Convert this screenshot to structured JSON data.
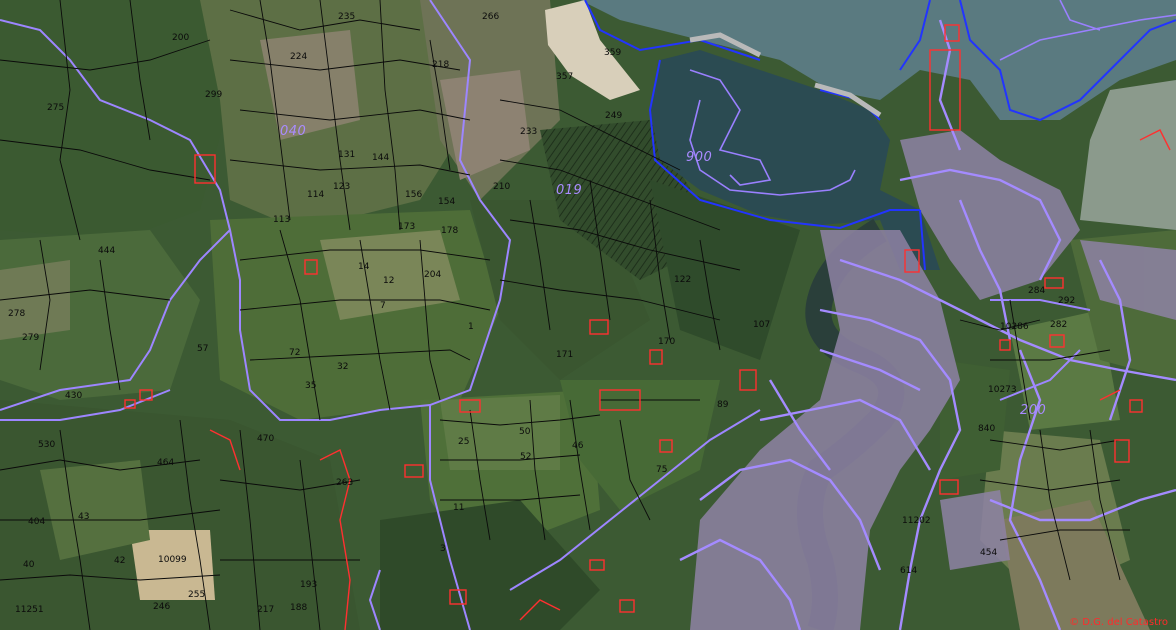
{
  "map": {
    "colors": {
      "sea": "#4e6e73",
      "bay": "#2f4d56",
      "beach": "#d9d2bf",
      "field_dark": "#2e4a27",
      "field_mid": "#4d6b3a",
      "field_light": "#7e8b5f",
      "bare_field": "#8a7f6a",
      "town": "#a07bd7",
      "road": "#9a82f2",
      "coast": "#1d2cff",
      "buildings": "#ff3b3b",
      "parcel_lines": "#0a0a0a"
    },
    "zone_labels": {
      "z040": "040",
      "z900": "900",
      "z200": "200",
      "z019": "019"
    },
    "parcel_labels": {
      "p200": "200",
      "p275": "275",
      "p279": "279",
      "p430": "430",
      "p278": "278",
      "p464": "464",
      "p470": "470",
      "p444": "444",
      "p299": "299",
      "p224": "224",
      "p113": "113",
      "p235": "235",
      "p266": "266",
      "p123": "123",
      "p131": "131",
      "p156": "156",
      "p144": "144",
      "p114": "114",
      "p154": "154",
      "p178": "178",
      "p204": "204",
      "p173": "173",
      "p357": "357",
      "p359": "359",
      "p249": "249",
      "p210": "210",
      "p218": "218",
      "p233": "233",
      "p122": "122",
      "p107": "107",
      "p57": "57",
      "p72": "72",
      "p7": "7",
      "p14": "14",
      "p35": "35",
      "p25": "25",
      "p50": "50",
      "p46": "46",
      "p75": "75",
      "p3": "3",
      "p11": "11",
      "p263": "263",
      "p188": "188",
      "p42": "42",
      "p10099": "10099",
      "p43": "43",
      "p40": "40",
      "p246": "246",
      "p255": "255",
      "p217": "217",
      "p193": "193",
      "p840": "840",
      "p10273": "10273",
      "p292": "292",
      "p284": "284",
      "p282": "282",
      "p10286": "10286",
      "p11202": "11202",
      "p454": "454",
      "p614": "614",
      "p530": "530",
      "p11251": "11251",
      "p404": "404",
      "p89": "89",
      "p170": "170",
      "p171": "171",
      "p1": "1",
      "p12": "12",
      "p32": "32",
      "p52": "52"
    },
    "copyright": "© D.G. del Catastro"
  }
}
